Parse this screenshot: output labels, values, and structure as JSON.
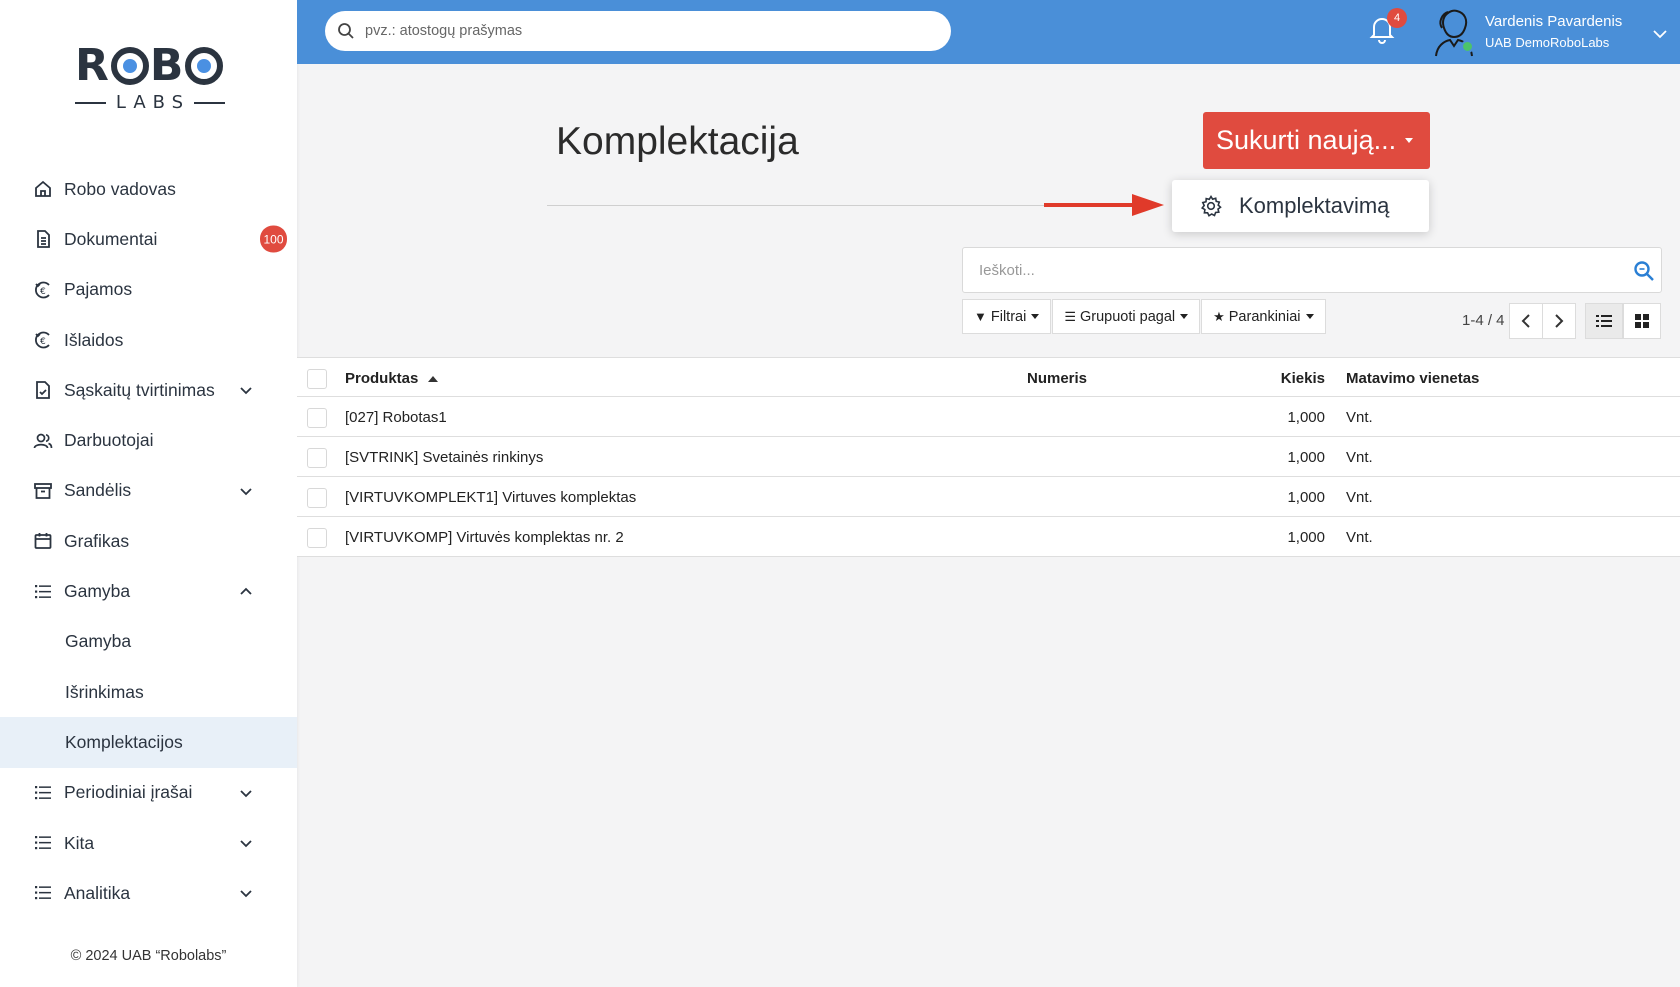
{
  "logo": {
    "brand": "ROBO",
    "sub": "LABS"
  },
  "topbar": {
    "search_placeholder": "pvz.: atostogų prašymas",
    "notification_count": "4",
    "user_name": "Vardenis Pavardenis",
    "user_company": "UAB DemoRoboLabs"
  },
  "sidebar": {
    "items": [
      {
        "label": "Robo vadovas",
        "icon": "home-icon"
      },
      {
        "label": "Dokumentai",
        "icon": "document-icon",
        "badge": "100"
      },
      {
        "label": "Pajamos",
        "icon": "euro-icon"
      },
      {
        "label": "Išlaidos",
        "icon": "euro-icon"
      },
      {
        "label": "Sąskaitų tvirtinimas",
        "icon": "document-check-icon",
        "expandable": true
      },
      {
        "label": "Darbuotojai",
        "icon": "users-icon"
      },
      {
        "label": "Sandėlis",
        "icon": "archive-icon",
        "expandable": true
      },
      {
        "label": "Grafikas",
        "icon": "calendar-icon"
      },
      {
        "label": "Gamyba",
        "icon": "list-icon",
        "expanded": true
      },
      {
        "label": "Gamyba",
        "sub": true
      },
      {
        "label": "Išrinkimas",
        "sub": true
      },
      {
        "label": "Komplektacijos",
        "sub": true,
        "active": true
      },
      {
        "label": "Periodiniai įrašai",
        "icon": "list-icon",
        "expandable": true
      },
      {
        "label": "Kita",
        "icon": "list-icon",
        "expandable": true
      },
      {
        "label": "Analitika",
        "icon": "list-icon",
        "expandable": true
      }
    ],
    "footer": "© 2024 UAB “Robolabs”"
  },
  "main": {
    "title": "Komplektacija",
    "create_button": "Sukurti naują...",
    "dropdown_item": "Komplektavimą",
    "search_placeholder": "Ieškoti...",
    "filters": "Filtrai",
    "group_by": "Grupuoti pagal",
    "favorites": "Parankiniai",
    "pager": "1-4 / 4"
  },
  "table": {
    "columns": [
      "Produktas",
      "Numeris",
      "Kiekis",
      "Matavimo vienetas"
    ],
    "rows": [
      {
        "product": "[027] Robotas1",
        "number": "",
        "qty": "1,000",
        "unit": "Vnt."
      },
      {
        "product": "[SVTRINK] Svetainės rinkinys",
        "number": "",
        "qty": "1,000",
        "unit": "Vnt."
      },
      {
        "product": "[VIRTUVKOMPLEKT1] Virtuves komplektas",
        "number": "",
        "qty": "1,000",
        "unit": "Vnt."
      },
      {
        "product": "[VIRTUVKOMP] Virtuvės komplektas nr. 2",
        "number": "",
        "qty": "1,000",
        "unit": "Vnt."
      }
    ]
  },
  "colors": {
    "topbar": "#4a8fd8",
    "accent_red": "#e04b3f",
    "active_sidebar": "#e8f0f8"
  }
}
